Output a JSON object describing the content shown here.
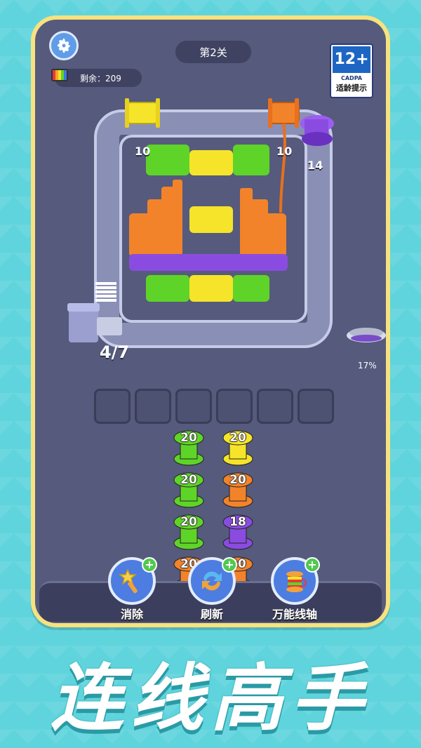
{
  "header": {
    "level": "第2关",
    "remaining_label": "剩余：209",
    "age_rating": {
      "number": "12+",
      "org": "CADPA",
      "caption": "适龄提示"
    }
  },
  "board": {
    "spool_counts": [
      "10",
      "10",
      "14"
    ],
    "progress": "4/7",
    "percent": "17%",
    "colors": {
      "green": "#5fd428",
      "yellow": "#f5e42a",
      "orange": "#f2832a",
      "purple": "#8a4ce0",
      "track": "#8a8fb5"
    }
  },
  "slots": {
    "count": 6
  },
  "spools": {
    "left_column": [
      {
        "value": "20",
        "color": "#5fd428"
      },
      {
        "value": "20",
        "color": "#5fd428"
      },
      {
        "value": "20",
        "color": "#5fd428"
      },
      {
        "value": "20",
        "color": "#f2832a"
      }
    ],
    "right_column": [
      {
        "value": "20",
        "color": "#f5e42a"
      },
      {
        "value": "20",
        "color": "#f2832a"
      },
      {
        "value": "18",
        "color": "#8a4ce0"
      },
      {
        "value": "20",
        "color": "#f2832a"
      }
    ]
  },
  "tools": [
    {
      "label": "消除",
      "icon": "magic-wand-icon"
    },
    {
      "label": "刷新",
      "icon": "refresh-icon"
    },
    {
      "label": "万能线轴",
      "icon": "universal-spool-icon"
    }
  ],
  "banner": {
    "title": "连线高手"
  }
}
